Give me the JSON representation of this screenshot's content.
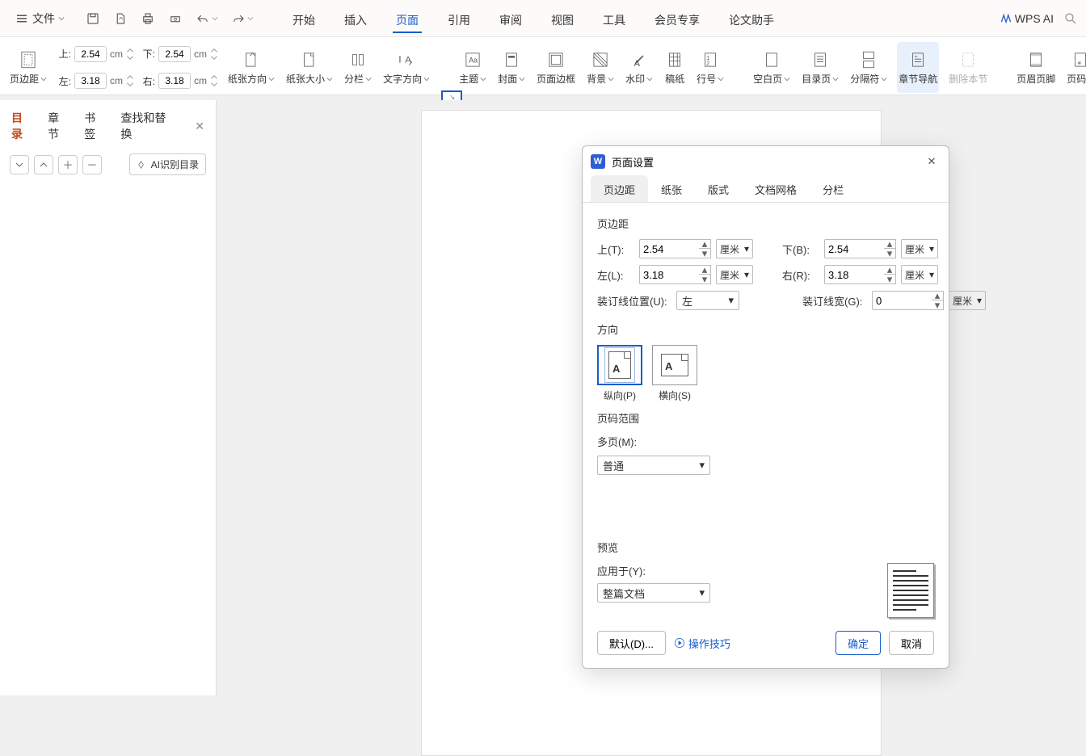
{
  "menubar": {
    "file": "文件",
    "tabs": [
      "开始",
      "插入",
      "页面",
      "引用",
      "审阅",
      "视图",
      "工具",
      "会员专享",
      "论文助手"
    ],
    "active_tab": 2,
    "wpsai": "WPS AI"
  },
  "ribbon": {
    "margins_label": "页边距",
    "top_lab": "上:",
    "top_val": "2.54",
    "bottom_lab": "下:",
    "bottom_val": "2.54",
    "left_lab": "左:",
    "left_val": "3.18",
    "right_lab": "右:",
    "right_val": "3.18",
    "unit": "cm",
    "orientation": "纸张方向",
    "size": "纸张大小",
    "columns": "分栏",
    "textdir": "文字方向",
    "theme": "主题",
    "cover": "封面",
    "border": "页面边框",
    "bg": "背景",
    "watermark": "水印",
    "manuscript": "稿纸",
    "linenum": "行号",
    "blank": "空白页",
    "toc": "目录页",
    "separator": "分隔符",
    "chapnav": "章节导航",
    "delsec": "删除本节",
    "hdrftr": "页眉页脚",
    "pagenum": "页码"
  },
  "sidepane": {
    "tabs": [
      "目录",
      "章节",
      "书签",
      "查找和替换"
    ],
    "active": 0,
    "ai_btn": "AI识别目录"
  },
  "dialog": {
    "title": "页面设置",
    "tabs": [
      "页边距",
      "纸张",
      "版式",
      "文档网格",
      "分栏"
    ],
    "active_tab": 0,
    "margins_section": "页边距",
    "top_l": "上(T):",
    "top_v": "2.54",
    "bottom_l": "下(B):",
    "bottom_v": "2.54",
    "left_l": "左(L):",
    "left_v": "3.18",
    "right_l": "右(R):",
    "right_v": "3.18",
    "gutter_pos_l": "装订线位置(U):",
    "gutter_pos_v": "左",
    "gutter_w_l": "装订线宽(G):",
    "gutter_w_v": "0",
    "unit": "厘米",
    "orient_section": "方向",
    "portrait": "纵向(P)",
    "landscape": "横向(S)",
    "range_section": "页码范围",
    "multi_l": "多页(M):",
    "multi_v": "普通",
    "preview_section": "预览",
    "apply_l": "应用于(Y):",
    "apply_v": "整篇文档",
    "default_btn": "默认(D)...",
    "tips": "操作技巧",
    "ok": "确定",
    "cancel": "取消"
  }
}
